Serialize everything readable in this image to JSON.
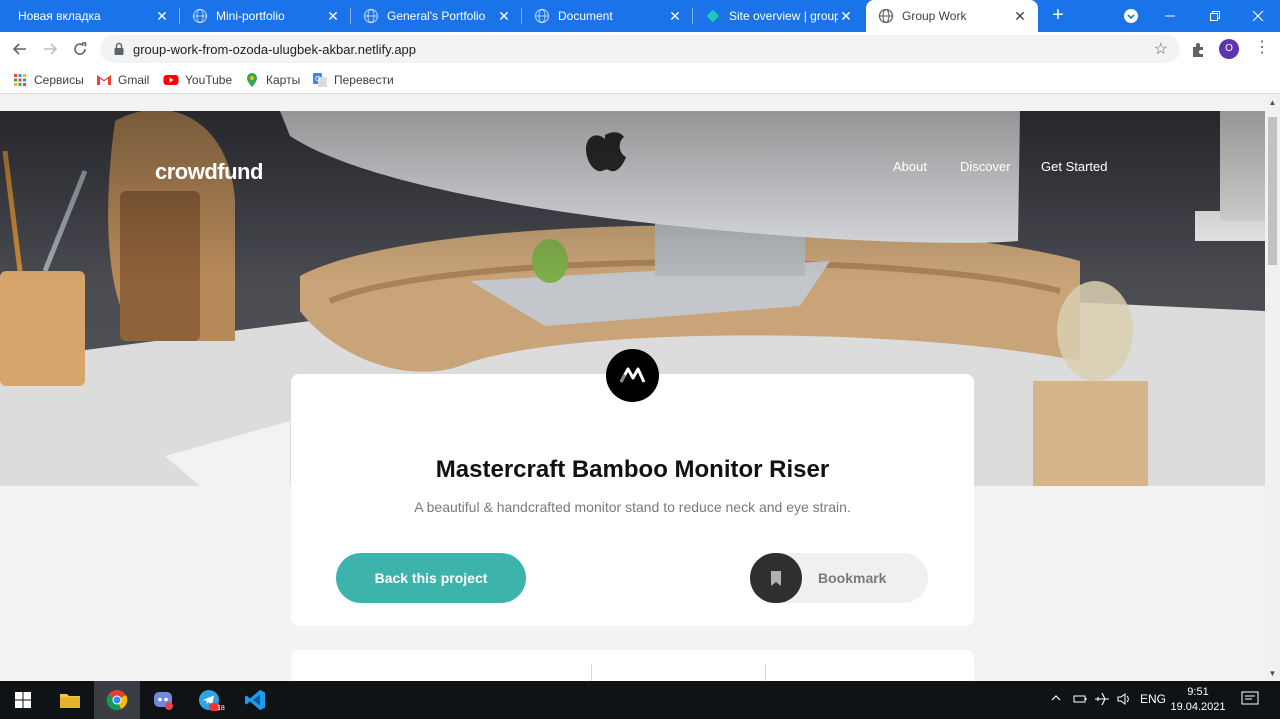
{
  "browser": {
    "tabs": [
      {
        "label": "Новая вкладка",
        "active": false
      },
      {
        "label": "Mini-portfolio",
        "active": false
      },
      {
        "label": "General's Portfolio",
        "active": false
      },
      {
        "label": "Document",
        "active": false
      },
      {
        "label": "Site overview | group-",
        "active": false
      },
      {
        "label": "Group Work",
        "active": true
      }
    ],
    "new_tab_glyph": "+",
    "url": "group-work-from-ozoda-ulugbek-akbar.netlify.app",
    "profile_initial": "O",
    "accent_color": "#1a73e8"
  },
  "bookmarks": [
    {
      "label": "Сервисы",
      "icon": "apps-grid-icon"
    },
    {
      "label": "Gmail",
      "icon": "gmail-icon"
    },
    {
      "label": "YouTube",
      "icon": "youtube-icon"
    },
    {
      "label": "Карты",
      "icon": "maps-icon"
    },
    {
      "label": "Перевести",
      "icon": "translate-icon"
    }
  ],
  "page": {
    "logo": "crowdfund",
    "nav": [
      "About",
      "Discover",
      "Get Started"
    ],
    "project": {
      "title": "Mastercraft Bamboo Monitor Riser",
      "subtitle": "A beautiful & handcrafted monitor stand to reduce neck and eye strain.",
      "back_label": "Back this project",
      "bookmark_label": "Bookmark"
    },
    "colors": {
      "primary": "#3cb4ac",
      "dark": "#2f2f2f"
    }
  },
  "taskbar": {
    "apps": [
      "windows-start-icon",
      "file-explorer-icon",
      "chrome-icon",
      "discord-icon",
      "telegram-icon",
      "vscode-icon"
    ],
    "telegram_badge": "18",
    "language": "ENG",
    "time": "9:51",
    "date": "19.04.2021"
  }
}
